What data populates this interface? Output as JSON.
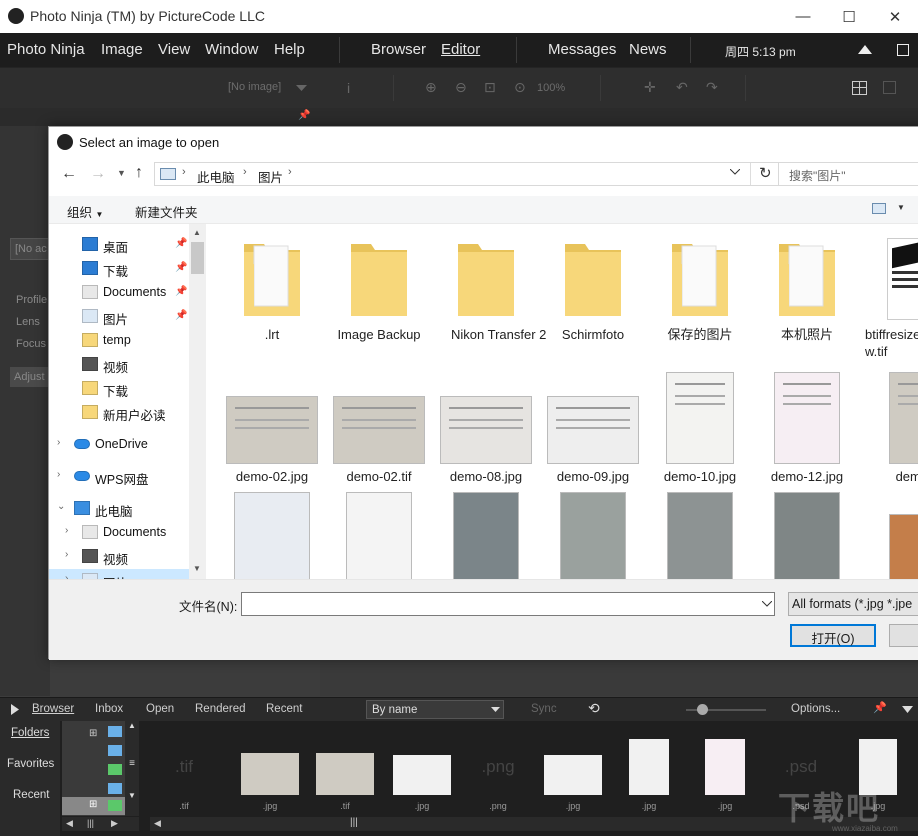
{
  "window": {
    "title": "Photo Ninja (TM) by PictureCode LLC"
  },
  "menubar": {
    "items": [
      "Photo Ninja",
      "Image",
      "View",
      "Window",
      "Help"
    ],
    "modes": [
      "Browser",
      "Editor"
    ],
    "extras": [
      "Messages",
      "News"
    ],
    "clock": "周四 5:13 pm"
  },
  "toolbar": {
    "image_select": "[No image]",
    "zoom": "100%"
  },
  "left_panel": {
    "image_field": "[No ac",
    "labels": [
      "Profile",
      "Lens",
      "Focus"
    ],
    "adjust_label": "Adjust"
  },
  "dialog": {
    "title": "Select an image to open",
    "path": [
      "此电脑",
      "图片"
    ],
    "search_placeholder": "搜索\"图片\"",
    "organize": "组织",
    "new_folder": "新建文件夹",
    "nav": [
      {
        "label": "桌面",
        "icon": "desktop-icon",
        "pinned": true
      },
      {
        "label": "下载",
        "icon": "download-icon",
        "pinned": true
      },
      {
        "label": "Documents",
        "icon": "document-icon",
        "pinned": true
      },
      {
        "label": "图片",
        "icon": "pictures-icon",
        "pinned": true
      },
      {
        "label": "temp",
        "icon": "folder-icon",
        "pinned": false
      },
      {
        "label": "视频",
        "icon": "video-icon",
        "pinned": false
      },
      {
        "label": "下载",
        "icon": "folder-icon",
        "pinned": false
      },
      {
        "label": "新用户必读",
        "icon": "folder-icon",
        "pinned": false
      },
      {
        "label": "OneDrive",
        "icon": "cloud-icon",
        "pinned": false
      },
      {
        "label": "WPS网盘",
        "icon": "cloud-icon",
        "pinned": false
      },
      {
        "label": "此电脑",
        "icon": "computer-icon",
        "pinned": false
      },
      {
        "label": "Documents",
        "icon": "document-icon",
        "pinned": false
      },
      {
        "label": "视频",
        "icon": "video-icon",
        "pinned": false
      },
      {
        "label": "图片",
        "icon": "pictures-icon",
        "pinned": false
      }
    ],
    "files_row1": [
      ".lrt",
      "Image Backup",
      "Nikon Transfer 2",
      "Schirmfoto",
      "保存的图片",
      "本机照片",
      "btiffresize w.tif"
    ],
    "files_row2": [
      "demo-02.jpg",
      "demo-02.tif",
      "demo-08.jpg",
      "demo-09.jpg",
      "demo-10.jpg",
      "demo-12.jpg",
      "demo-"
    ],
    "filename_label": "文件名(N):",
    "filename_value": "",
    "filter": "All formats (*.jpg *.jpe",
    "open_button": "打开(O)",
    "cancel_button": ""
  },
  "browser_panel": {
    "tabs": [
      "Browser",
      "Inbox",
      "Open",
      "Rendered",
      "Recent"
    ],
    "sort": "By name",
    "sync": "Sync",
    "options": "Options...",
    "side": [
      "Folders",
      "Favorites",
      "Recent"
    ],
    "thumb_ext": [
      ".tif",
      ".jpg",
      ".tif",
      ".jpg",
      ".png",
      ".jpg",
      ".jpg",
      ".jpg",
      ".psd",
      ".jpg"
    ],
    "thumb_big": {
      "tif": ".tif",
      "png": ".png",
      "psd": ".psd"
    }
  },
  "watermark": {
    "text": "下载吧",
    "url": "www.xiazaiba.com"
  },
  "colors": {
    "folder": "#f7d77a",
    "accent": "#0078d7",
    "selected": "#cce8ff",
    "dark": "#1d1d1d"
  }
}
